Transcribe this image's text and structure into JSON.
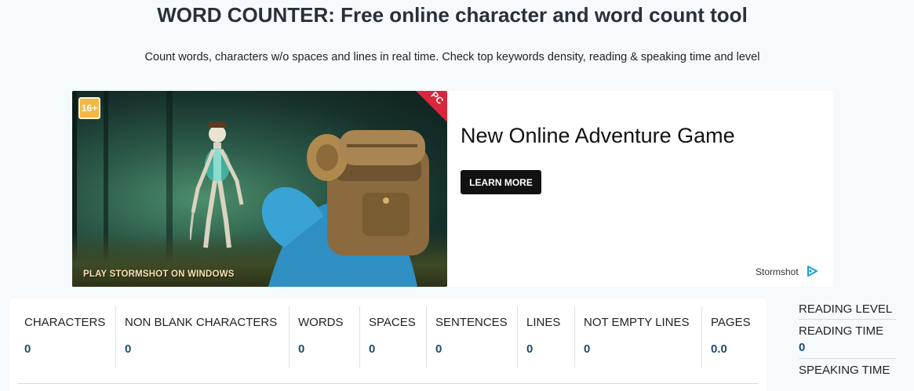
{
  "header": {
    "title": "WORD COUNTER: Free online character and word count tool",
    "subtitle": "Count words, characters w/o spaces and lines in real time. Check top keywords density, reading & speaking time and level"
  },
  "ad": {
    "badge": "16+",
    "corner_label": "PC",
    "image_caption": "PLAY STORMSHOT ON WINDOWS",
    "headline": "New Online Adventure Game",
    "cta_label": "LEARN MORE",
    "brand": "Stormshot",
    "adchoices_icon": "adchoices-icon"
  },
  "stats": [
    {
      "label": "CHARACTERS",
      "value": "0"
    },
    {
      "label": "NON BLANK CHARACTERS",
      "value": "0"
    },
    {
      "label": "WORDS",
      "value": "0"
    },
    {
      "label": "SPACES",
      "value": "0"
    },
    {
      "label": "SENTENCES",
      "value": "0"
    },
    {
      "label": "LINES",
      "value": "0"
    },
    {
      "label": "NOT EMPTY LINES",
      "value": "0"
    },
    {
      "label": "PAGES",
      "value": "0.0"
    }
  ],
  "side": {
    "reading_level_label": "READING LEVEL",
    "reading_time_label": "READING TIME",
    "reading_time_value": "0",
    "speaking_time_label": "SPEAKING TIME"
  },
  "colors": {
    "background": "#f7fafd",
    "value_text": "#1c4d6b",
    "cta_bg": "#111111",
    "adchoices": "#1aa1d1"
  }
}
